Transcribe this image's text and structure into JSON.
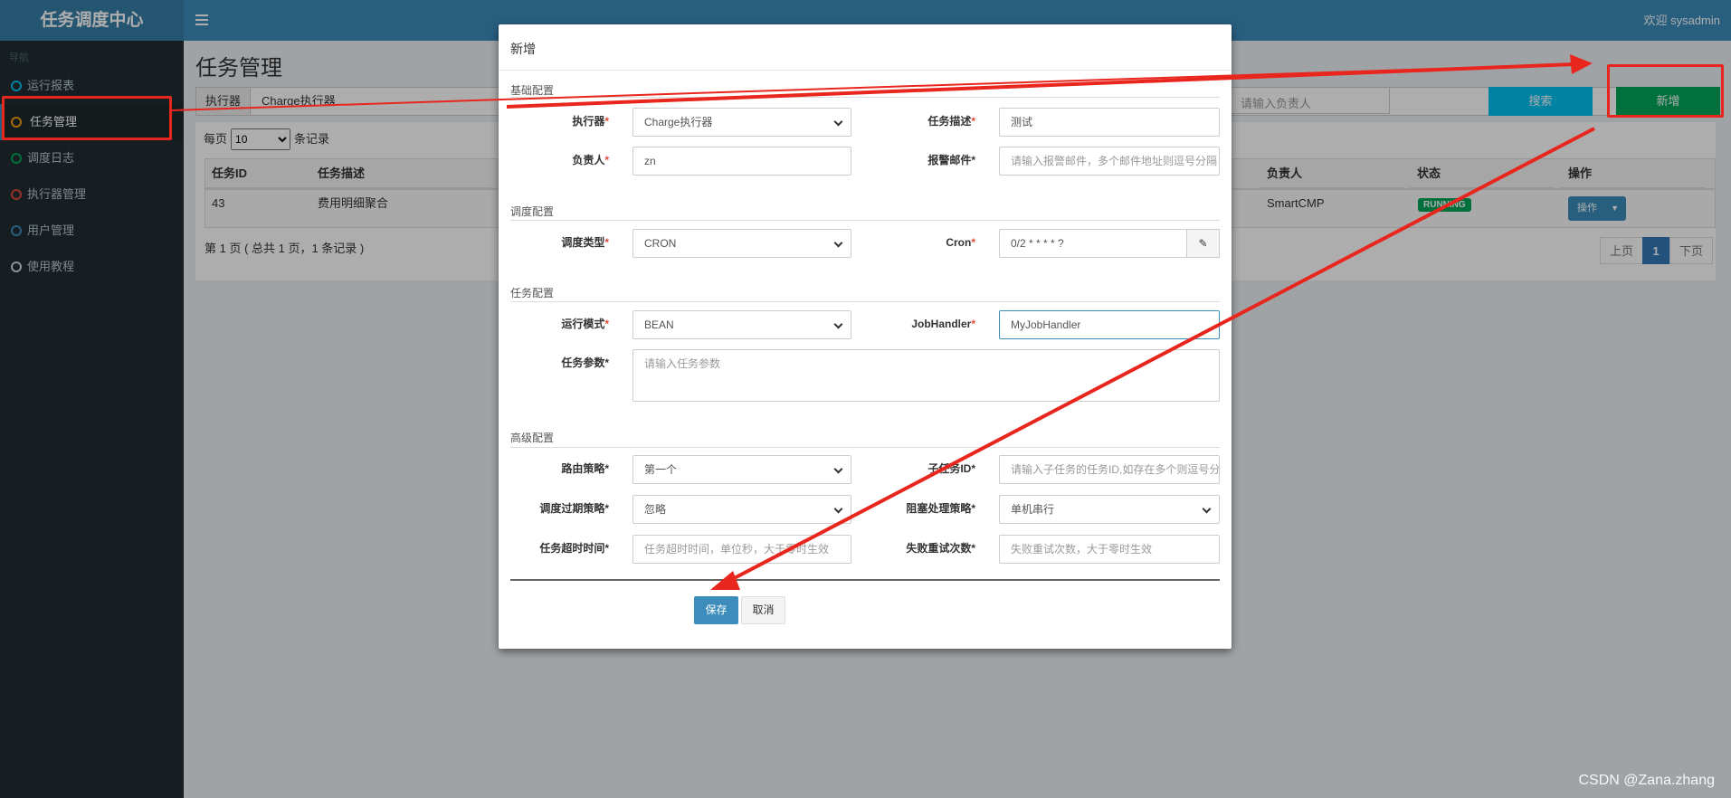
{
  "header": {
    "logo": "任务调度中心",
    "welcome": "欢迎 sysadmin"
  },
  "sidebar": {
    "nav_label": "导航",
    "items": [
      {
        "label": "运行报表",
        "color": "#00c0ef"
      },
      {
        "label": "任务管理",
        "color": "#f39c12"
      },
      {
        "label": "调度日志",
        "color": "#00a65a"
      },
      {
        "label": "执行器管理",
        "color": "#dd4b39"
      },
      {
        "label": "用户管理",
        "color": "#3c8dbc"
      },
      {
        "label": "使用教程",
        "color": "#d2d6de"
      }
    ]
  },
  "main": {
    "title": "任务管理",
    "filter_label": "执行器",
    "filter_value": "Charge执行器",
    "owner_placeholder": "请输入负责人",
    "search_button": "搜索",
    "add_button": "新增",
    "per_page_prefix": "每页",
    "per_page_value": "10",
    "per_page_suffix": "条记录",
    "columns": [
      "任务ID",
      "任务描述",
      "负责人",
      "状态",
      "操作"
    ],
    "row": {
      "id": "43",
      "desc": "费用明细聚合",
      "owner": "SmartCMP",
      "status": "RUNNING",
      "op": "操作"
    },
    "page_info": "第 1 页 ( 总共 1 页，1 条记录 )",
    "pager": {
      "prev": "上页",
      "current": "1",
      "next": "下页"
    }
  },
  "modal": {
    "title": "新增",
    "sections": {
      "basic": "基础配置",
      "schedule": "调度配置",
      "task": "任务配置",
      "advanced": "高级配置"
    },
    "fields": {
      "executor": {
        "label": "执行器",
        "value": "Charge执行器"
      },
      "job_desc": {
        "label": "任务描述",
        "value": "测试"
      },
      "owner": {
        "label": "负责人",
        "value": "zn"
      },
      "alarm_email": {
        "label": "报警邮件",
        "placeholder": "请输入报警邮件，多个邮件地址则逗号分隔"
      },
      "schedule_type": {
        "label": "调度类型",
        "value": "CRON"
      },
      "cron": {
        "label": "Cron",
        "value": "0/2 * * * * ?"
      },
      "run_mode": {
        "label": "运行模式",
        "value": "BEAN"
      },
      "job_handler": {
        "label": "JobHandler",
        "value": "MyJobHandler"
      },
      "job_param": {
        "label": "任务参数",
        "placeholder": "请输入任务参数"
      },
      "route_strategy": {
        "label": "路由策略",
        "value": "第一个"
      },
      "child_job": {
        "label": "子任务ID",
        "placeholder": "请输入子任务的任务ID,如存在多个则逗号分隔"
      },
      "misfire": {
        "label": "调度过期策略",
        "value": "忽略"
      },
      "block_strategy": {
        "label": "阻塞处理策略",
        "value": "单机串行"
      },
      "timeout": {
        "label": "任务超时时间",
        "placeholder": "任务超时时间，单位秒，大于零时生效"
      },
      "fail_retry": {
        "label": "失败重试次数",
        "placeholder": "失败重试次数，大于零时生效"
      }
    },
    "save_button": "保存",
    "cancel_button": "取消"
  },
  "watermark": "CSDN @Zana.zhang",
  "colors": {
    "primary": "#3c8dbc",
    "success": "#00a65a",
    "info": "#00c0ef",
    "annotation": "#e8261e"
  }
}
